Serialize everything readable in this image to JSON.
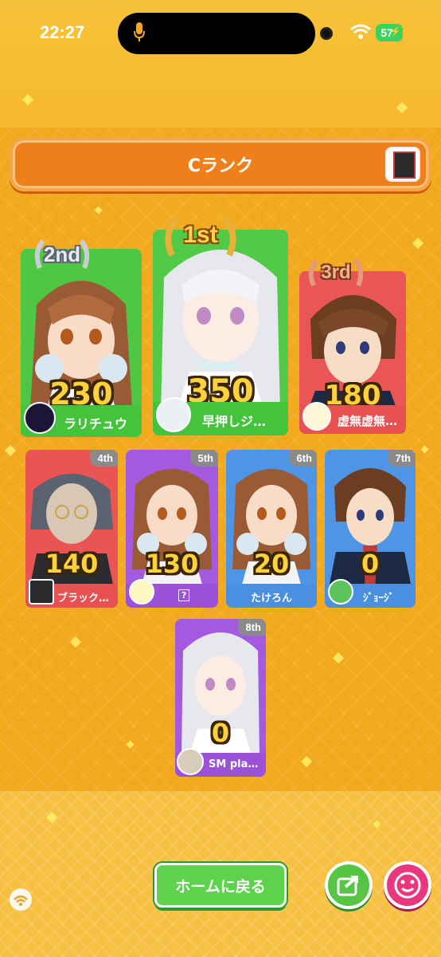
{
  "status_bar": {
    "time": "22:27",
    "battery": "57"
  },
  "header": {
    "rank_title": "Cランク"
  },
  "podium": [
    {
      "place_label": "2nd",
      "score": "230",
      "name": "ラリチュウ",
      "color": "#46c33c"
    },
    {
      "place_label": "1st",
      "score": "350",
      "name": "早押しジ…",
      "color": "#46c33c"
    },
    {
      "place_label": "3rd",
      "score": "180",
      "name": "虚無虚無…",
      "color": "#e85151"
    }
  ],
  "others": [
    {
      "place_label": "4th",
      "score": "140",
      "name": "ブラック…",
      "color": "#e85151"
    },
    {
      "place_label": "5th",
      "score": "130",
      "name": "?",
      "color": "#9b52d9"
    },
    {
      "place_label": "6th",
      "score": "20",
      "name": "たけろん",
      "color": "#4a8fe0"
    },
    {
      "place_label": "7th",
      "score": "0",
      "name": "ｼﾞｮｰｼﾞ",
      "color": "#4a8fe0"
    },
    {
      "place_label": "8th",
      "score": "0",
      "name": "SM pla…",
      "color": "#9b52d9"
    }
  ],
  "footer": {
    "home_button": "ホームに戻る"
  }
}
